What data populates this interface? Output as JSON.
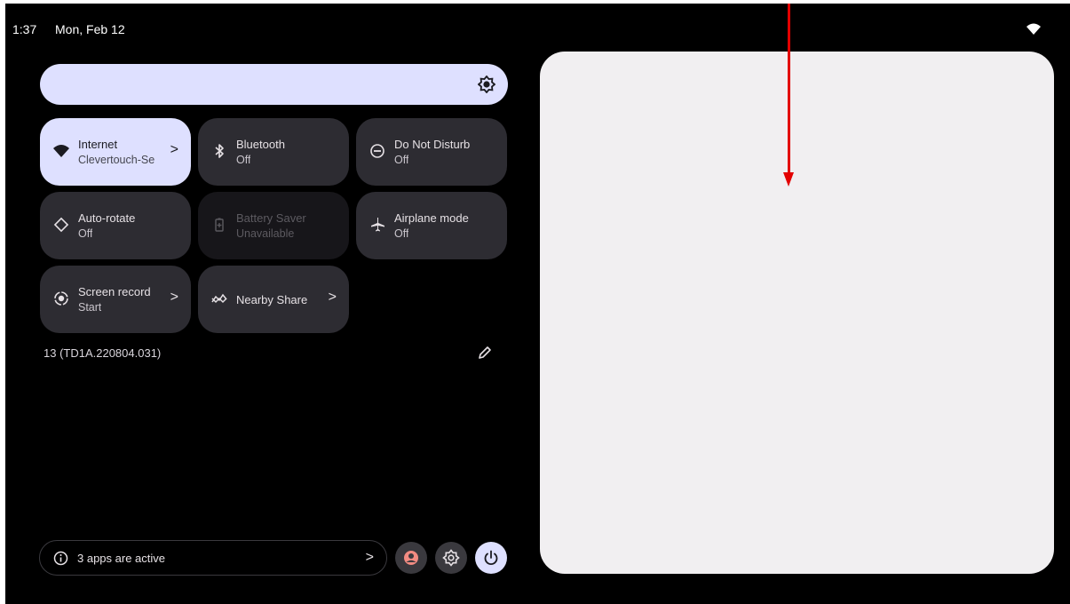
{
  "status_bar": {
    "time": "1:37",
    "date": "Mon, Feb 12",
    "wifi_icon": "wifi-icon"
  },
  "brightness": {
    "icon": "brightness-icon",
    "level": 1.0
  },
  "tiles": [
    {
      "label": "Internet",
      "subtitle": "Clevertouch-Se",
      "icon": "wifi-icon",
      "state": "on",
      "has_chevron": true
    },
    {
      "label": "Bluetooth",
      "subtitle": "Off",
      "icon": "bluetooth-icon",
      "state": "off",
      "has_chevron": false
    },
    {
      "label": "Do Not Disturb",
      "subtitle": "Off",
      "icon": "do-not-disturb-icon",
      "state": "off",
      "has_chevron": false
    },
    {
      "label": "Auto-rotate",
      "subtitle": "Off",
      "icon": "auto-rotate-icon",
      "state": "off",
      "has_chevron": false
    },
    {
      "label": "Battery Saver",
      "subtitle": "Unavailable",
      "icon": "battery-saver-icon",
      "state": "unavailable",
      "has_chevron": false
    },
    {
      "label": "Airplane mode",
      "subtitle": "Off",
      "icon": "airplane-icon",
      "state": "off",
      "has_chevron": false
    },
    {
      "label": "Screen record",
      "subtitle": "Start",
      "icon": "screen-record-icon",
      "state": "off",
      "has_chevron": true
    },
    {
      "label": "Nearby Share",
      "subtitle": "",
      "icon": "nearby-share-icon",
      "state": "off",
      "has_chevron": true
    }
  ],
  "chevron": ">",
  "build_number": "13 (TD1A.220804.031)",
  "footer": {
    "active_apps_label": "3 apps are active",
    "buttons": [
      "user-icon",
      "settings-icon",
      "power-icon"
    ]
  },
  "colors": {
    "accent": "#dee0ff",
    "tile_off": "#2d2c32",
    "annotation_arrow": "#e30000",
    "notification_panel": "#f1eff1"
  }
}
